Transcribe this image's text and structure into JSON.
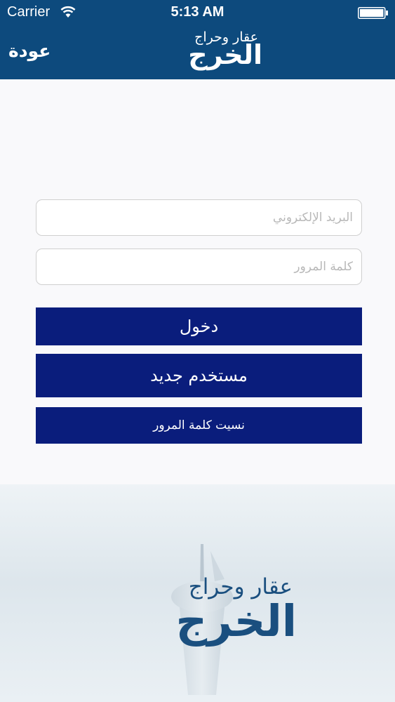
{
  "status_bar": {
    "carrier": "Carrier",
    "time": "5:13 AM"
  },
  "nav": {
    "back_label": "عودة",
    "logo_top": "عقار وحراج",
    "logo_main": "الخرج"
  },
  "form": {
    "email_placeholder": "البريد الإلكتروني",
    "password_placeholder": "كلمة المرور"
  },
  "buttons": {
    "login": "دخول",
    "register": "مستخدم جديد",
    "forgot": "نسيت كلمة المرور"
  },
  "footer_logo": {
    "logo_top": "عقار وحراج",
    "logo_main": "الخرج"
  },
  "colors": {
    "header": "#0d4a7d",
    "button": "#0a1d7c",
    "logo": "#1a4f7f"
  }
}
